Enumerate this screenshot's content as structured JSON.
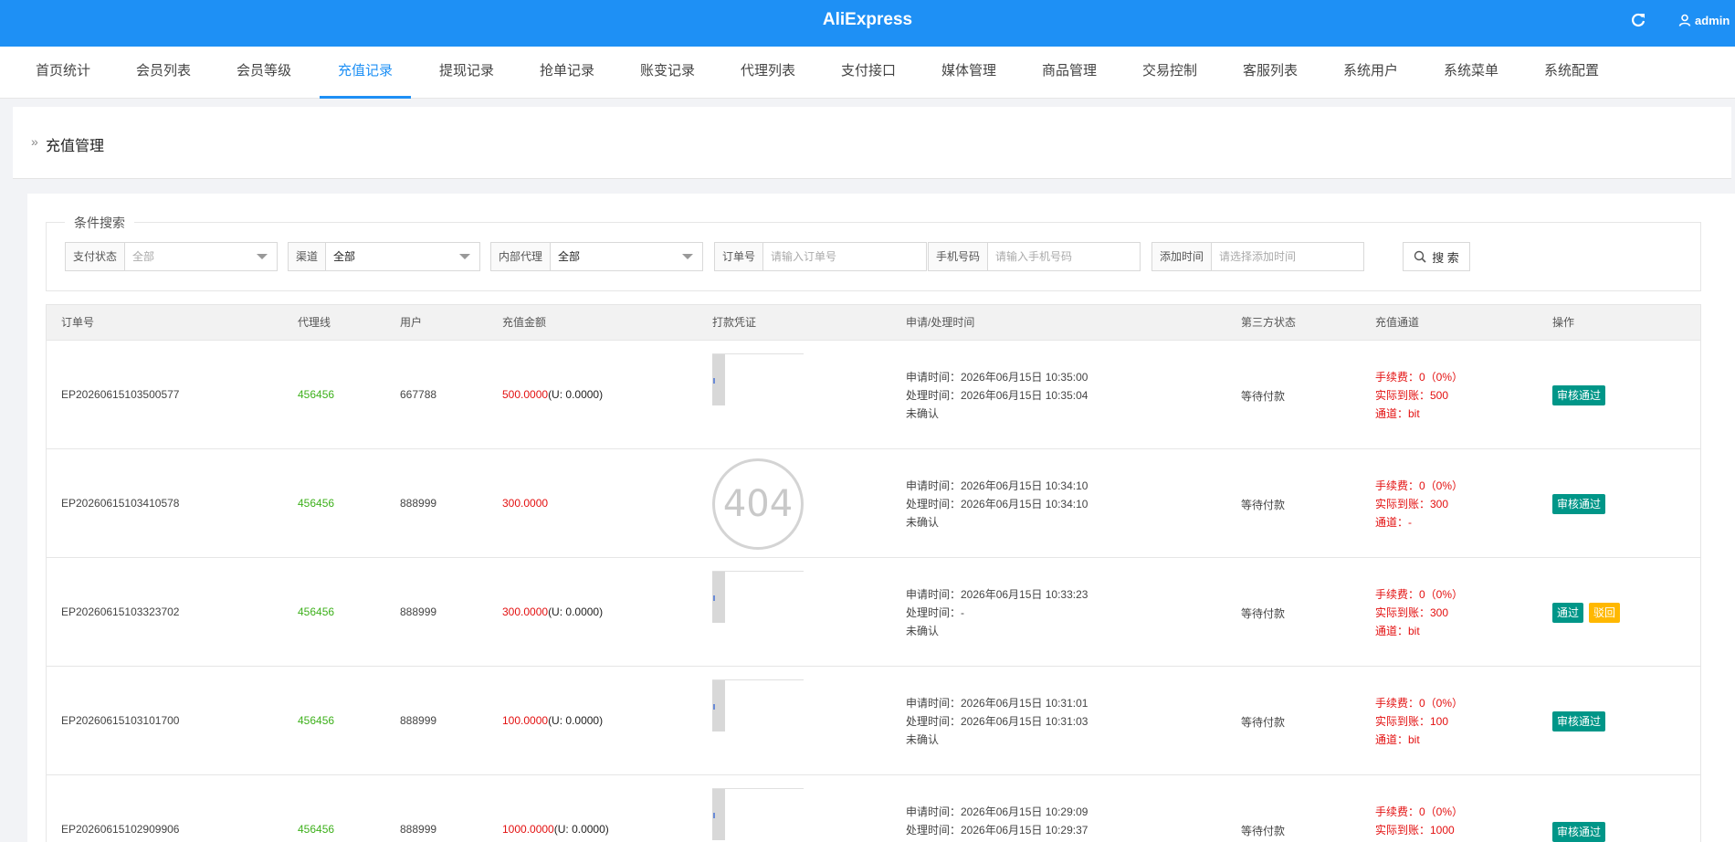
{
  "header": {
    "brand": "AliExpress",
    "user": "admin"
  },
  "nav": {
    "tabs": [
      {
        "label": "首页统计"
      },
      {
        "label": "会员列表"
      },
      {
        "label": "会员等级"
      },
      {
        "label": "充值记录"
      },
      {
        "label": "提现记录"
      },
      {
        "label": "抢单记录"
      },
      {
        "label": "账变记录"
      },
      {
        "label": "代理列表"
      },
      {
        "label": "支付接口"
      },
      {
        "label": "媒体管理"
      },
      {
        "label": "商品管理"
      },
      {
        "label": "交易控制"
      },
      {
        "label": "客服列表"
      },
      {
        "label": "系统用户"
      },
      {
        "label": "系统菜单"
      },
      {
        "label": "系统配置"
      }
    ],
    "active": "充值记录"
  },
  "breadcrumb": {
    "title": "充值管理"
  },
  "search": {
    "legend": "条件搜索",
    "pay_status": {
      "label": "支付状态",
      "value": "全部"
    },
    "channel": {
      "label": "渠道",
      "value": "全部"
    },
    "agent": {
      "label": "内部代理",
      "value": "全部"
    },
    "order_no": {
      "label": "订单号",
      "placeholder": "请输入订单号"
    },
    "phone": {
      "label": "手机号码",
      "placeholder": "请输入手机号码"
    },
    "add_time": {
      "label": "添加时间",
      "placeholder": "请选择添加时间"
    },
    "button": "搜 索"
  },
  "table": {
    "headers": [
      "订单号",
      "代理线",
      "用户",
      "充值金额",
      "打款凭证",
      "申请/处理时间",
      "第三方状态",
      "充值通道",
      "操作"
    ],
    "rows": [
      {
        "order": "EP20260615103500577",
        "agent": "456456",
        "user": "667788",
        "amount": "500.0000",
        "usdt": "(U: 0.0000)",
        "proof": "thumb",
        "apply": "申请时间：2026年06月15日 10:35:00",
        "process": "处理时间：2026年06月15日 10:35:04",
        "confirm": "未确认",
        "third": "等待付款",
        "fee": "手续费：0（0%）",
        "actual": "实际到账：500",
        "via": "通道：bit",
        "actions": [
          "审核通过"
        ]
      },
      {
        "order": "EP20260615103410578",
        "agent": "456456",
        "user": "888999",
        "amount": "300.0000",
        "usdt": "",
        "proof": "404",
        "apply": "申请时间：2026年06月15日 10:34:10",
        "process": "处理时间：2026年06月15日 10:34:10",
        "confirm": "未确认",
        "third": "等待付款",
        "fee": "手续费：0（0%）",
        "actual": "实际到账：300",
        "via": "通道：-",
        "actions": [
          "审核通过"
        ]
      },
      {
        "order": "EP20260615103323702",
        "agent": "456456",
        "user": "888999",
        "amount": "300.0000",
        "usdt": "(U: 0.0000)",
        "proof": "thumb",
        "apply": "申请时间：2026年06月15日 10:33:23",
        "process": "处理时间：-",
        "confirm": "未确认",
        "third": "等待付款",
        "fee": "手续费：0（0%）",
        "actual": "实际到账：300",
        "via": "通道：bit",
        "actions": [
          "通过",
          "驳回"
        ]
      },
      {
        "order": "EP20260615103101700",
        "agent": "456456",
        "user": "888999",
        "amount": "100.0000",
        "usdt": "(U: 0.0000)",
        "proof": "thumb",
        "apply": "申请时间：2026年06月15日 10:31:01",
        "process": "处理时间：2026年06月15日 10:31:03",
        "confirm": "未确认",
        "third": "等待付款",
        "fee": "手续费：0（0%）",
        "actual": "实际到账：100",
        "via": "通道：bit",
        "actions": [
          "审核通过"
        ]
      },
      {
        "order": "EP20260615102909906",
        "agent": "456456",
        "user": "888999",
        "amount": "1000.0000",
        "usdt": "(U: 0.0000)",
        "proof": "thumb",
        "apply": "申请时间：2026年06月15日 10:29:09",
        "process": "处理时间：2026年06月15日 10:29:37",
        "confirm": "",
        "third": "等待付款",
        "fee": "手续费：0（0%）",
        "actual": "实际到账：1000",
        "via": "",
        "actions": [
          "审核通过"
        ]
      }
    ]
  },
  "colors": {
    "primary": "#1e90f5",
    "teal": "#009688",
    "orange": "#ffb800",
    "red": "#e31010",
    "green": "#3db01b"
  }
}
